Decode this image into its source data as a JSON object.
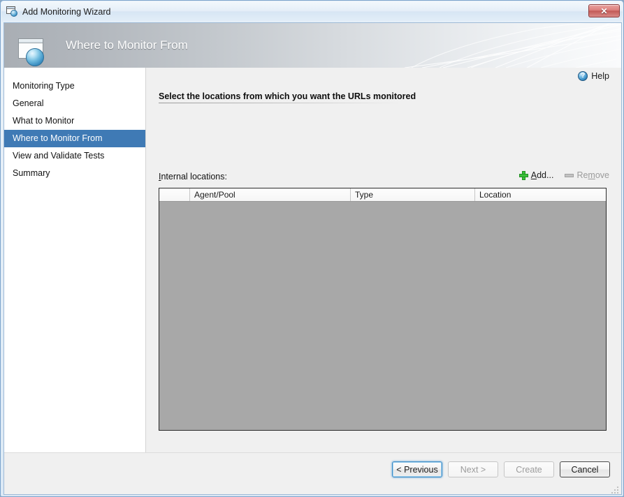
{
  "window": {
    "title": "Add Monitoring Wizard",
    "icon": "wizard-window-icon",
    "close_label": "✕"
  },
  "banner": {
    "title": "Where to Monitor From",
    "icon": "wizard-window-sphere-icon"
  },
  "sidebar": {
    "items": [
      {
        "label": "Monitoring Type",
        "selected": false
      },
      {
        "label": "General",
        "selected": false
      },
      {
        "label": "What to Monitor",
        "selected": false
      },
      {
        "label": "Where to Monitor From",
        "selected": true
      },
      {
        "label": "View and Validate Tests",
        "selected": false
      },
      {
        "label": "Summary",
        "selected": false
      }
    ]
  },
  "content": {
    "help": {
      "label": "Help",
      "icon": "help-question-icon"
    },
    "heading": "Select the locations from which you want the URLs monitored",
    "locations_label_prefix": "I",
    "locations_label_rest": "nternal locations:",
    "toolbar": {
      "add": {
        "prefix": "A",
        "accel": "",
        "rest": "dd...",
        "label": "Add...",
        "icon": "plus-icon",
        "enabled": true
      },
      "remove": {
        "pre": "Re",
        "accel": "m",
        "post": "ove",
        "label": "Remove",
        "icon": "minus-icon",
        "enabled": false
      }
    },
    "grid": {
      "columns": [
        "",
        "Agent/Pool",
        "Type",
        "Location"
      ],
      "rows": []
    }
  },
  "footer": {
    "buttons": [
      {
        "label": "< Previous",
        "state": "focused"
      },
      {
        "label": "Next >",
        "state": "disabled"
      },
      {
        "label": "Create",
        "state": "disabled"
      },
      {
        "label": "Cancel",
        "state": "default"
      }
    ]
  },
  "colors": {
    "accent_blue": "#3f7ab5",
    "grid_body_grey": "#a8a8a8",
    "content_bg": "#f0f0f0",
    "add_green": "#3cc13c",
    "close_red": "#c25a57"
  }
}
